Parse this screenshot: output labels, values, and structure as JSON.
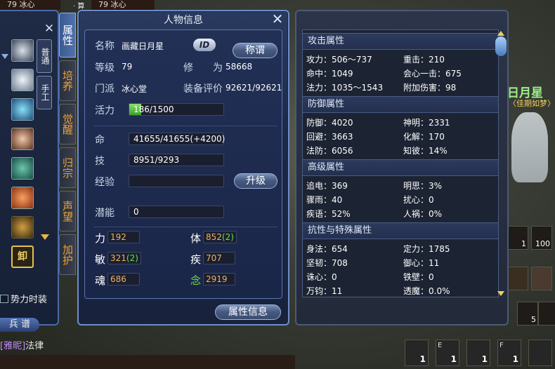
{
  "background": {
    "nameplate_left": "79   冰心",
    "nameplate_center": "79   冰心",
    "top_tiny": "· 算",
    "right_name": "日月星",
    "right_title": "〈佳期如梦〉",
    "chat_who": "[雅昵]",
    "chat_text": "法律",
    "sky_slot_1_num": "1",
    "sky_slot_2_num": "100",
    "bottom_slots": [
      "1",
      "1",
      "1",
      "1"
    ],
    "bottom_slot_labels": [
      "",
      "E",
      "",
      "F"
    ],
    "skill_num_1": "5"
  },
  "left_panel": {
    "tabs": [
      "普通",
      "手工"
    ],
    "checkbox_label": "势力时装",
    "spectrum_label": "兵 谱",
    "skill_icons": [
      "ghost-mask-icon",
      "white-robe-icon",
      "wing-icon",
      "portrait-icon",
      "horse-icon",
      "fox-icon",
      "chest-icon",
      "unload-icon"
    ],
    "unload_label": "卸"
  },
  "side_tabs": [
    "属性",
    "培养",
    "觉醒",
    "归宗",
    "声望",
    "加护"
  ],
  "character": {
    "window_title": "人物信息",
    "name_label": "名称",
    "name_value": "画藏日月星",
    "id_badge": "ID",
    "title_button": "称谓",
    "level_label": "等级",
    "level_value": "79",
    "cultivation_label": "修　　为",
    "cultivation_value": "58668",
    "faction_label": "门派",
    "faction_value": "冰心堂",
    "gear_label": "装备评价",
    "gear_value": "92621/92621",
    "vigor_label": "活力",
    "vigor_value": "186/1500",
    "vigor_fraction": 0.124,
    "hp_label": "命",
    "hp_value": "41655/41655(+4200)",
    "skill_label": "技",
    "skill_value": "8951/9293",
    "exp_label": "经验",
    "upgrade_button": "升级",
    "potential_label": "潜能",
    "potential_value": "0",
    "attrs": {
      "str_label": "力",
      "str_value": "192",
      "body_label": "体",
      "body_value": "852",
      "body_bonus": "(2)",
      "agi_label": "敏",
      "agi_value": "321",
      "agi_bonus": "(2)",
      "swift_label": "疾",
      "swift_value": "707",
      "soul_label": "魂",
      "soul_value": "686",
      "focus_label": "念",
      "focus_value": "2919"
    },
    "attr_info_button": "属性信息"
  },
  "attributes": {
    "sections": [
      {
        "head": "攻击属性",
        "rows": [
          [
            "攻力：506～737",
            "重击：210"
          ],
          [
            "命中：1049",
            "会心一击：675"
          ],
          [
            "法力：1035～1543",
            "附加伤害：98"
          ]
        ]
      },
      {
        "head": "防御属性",
        "rows": [
          [
            "防御：4020",
            "神明：2331"
          ],
          [
            "回避：3663",
            "化解：170"
          ],
          [
            "法防：6056",
            "知彼：14%"
          ]
        ]
      },
      {
        "head": "高级属性",
        "rows": [
          [
            "追电：369",
            "明思：3%"
          ],
          [
            "骤雨：40",
            "扰心：0"
          ],
          [
            "疾语：52%",
            "人祸：0%"
          ]
        ]
      },
      {
        "head": "抗性与特殊属性",
        "rows": [
          [
            "身法：654",
            "定力：1785"
          ],
          [
            "坚韧：708",
            "御心：11"
          ],
          [
            "诛心：0",
            "铁壁：0"
          ],
          [
            "万钧：11",
            "透魔：0.0%"
          ]
        ]
      }
    ]
  }
}
